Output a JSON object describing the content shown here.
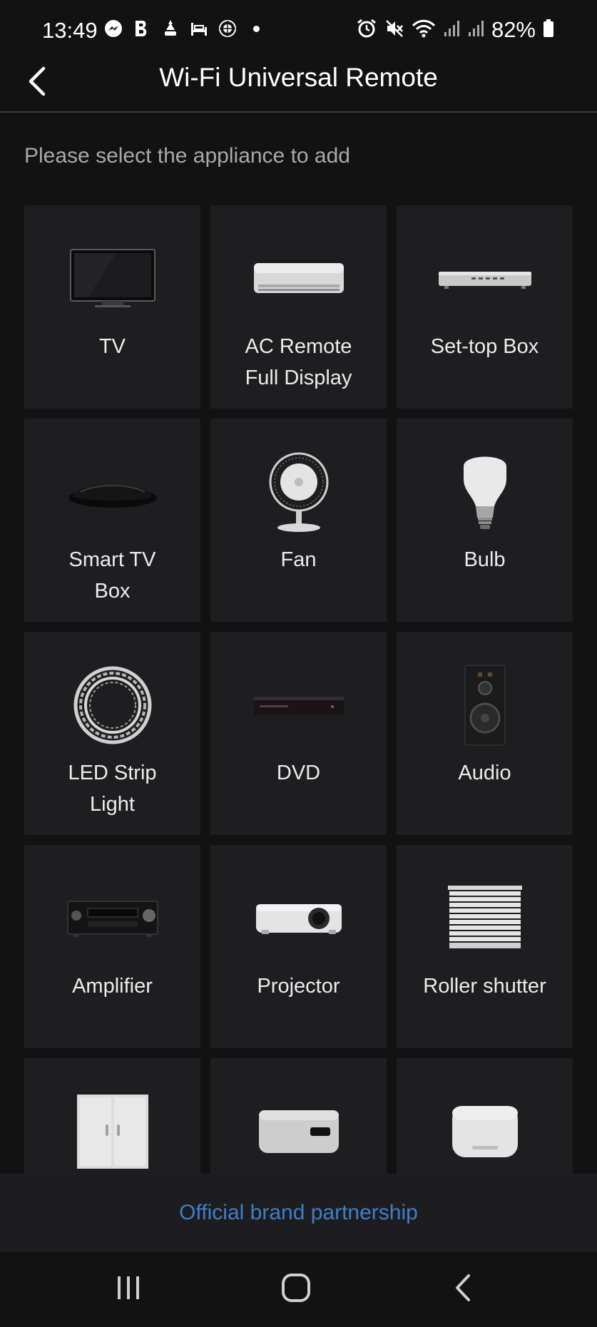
{
  "status_bar": {
    "time": "13:49",
    "battery": "82%",
    "icons": [
      "messenger-icon",
      "b-app-icon",
      "lantern-icon",
      "bed-icon",
      "emblem-icon",
      "notification-dot-icon",
      "alarm-icon",
      "mute-icon",
      "wifi-icon",
      "signal-icon",
      "signal-icon",
      "battery-icon"
    ]
  },
  "header": {
    "title": "Wi-Fi Universal Remote",
    "back_icon": "chevron-left-icon"
  },
  "subtitle": "Please select the appliance to add",
  "appliances": [
    {
      "label": "TV",
      "icon": "tv-icon"
    },
    {
      "label": "AC Remote\nFull Display",
      "icon": "air-conditioner-icon"
    },
    {
      "label": "Set-top Box",
      "icon": "set-top-box-icon"
    },
    {
      "label": "Smart TV\nBox",
      "icon": "smart-tv-box-icon"
    },
    {
      "label": "Fan",
      "icon": "fan-icon"
    },
    {
      "label": "Bulb",
      "icon": "bulb-icon"
    },
    {
      "label": "LED Strip\nLight",
      "icon": "led-strip-icon"
    },
    {
      "label": "DVD",
      "icon": "dvd-player-icon"
    },
    {
      "label": "Audio",
      "icon": "speaker-icon"
    },
    {
      "label": "Amplifier",
      "icon": "amplifier-icon"
    },
    {
      "label": "Projector",
      "icon": "projector-icon"
    },
    {
      "label": "Roller shutter",
      "icon": "roller-shutter-icon"
    },
    {
      "label": "",
      "icon": "cabinet-icon"
    },
    {
      "label": "",
      "icon": "water-heater-icon"
    },
    {
      "label": "",
      "icon": "air-purifier-icon"
    }
  ],
  "footer": {
    "link": "Official brand partnership",
    "link_color": "#3d7fc9"
  },
  "nav_bar": {
    "icons": [
      "recent-apps-icon",
      "home-icon",
      "back-icon"
    ]
  }
}
